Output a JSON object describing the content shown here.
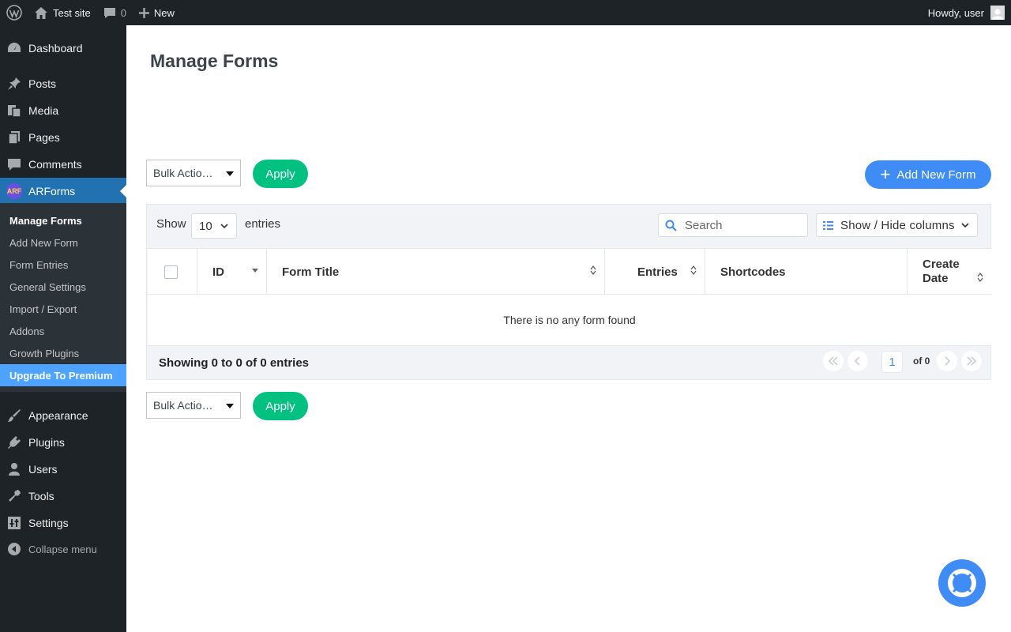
{
  "adminbar": {
    "site_name": "Test site",
    "comments_count": "0",
    "new_label": "New",
    "greeting": "Howdy, user"
  },
  "sidebar": {
    "items": [
      {
        "label": "Dashboard",
        "icon": "dashboard-icon"
      },
      {
        "label": "Posts",
        "icon": "pin-icon"
      },
      {
        "label": "Media",
        "icon": "media-icon"
      },
      {
        "label": "Pages",
        "icon": "pages-icon"
      },
      {
        "label": "Comments",
        "icon": "comment-icon"
      },
      {
        "label": "ARForms",
        "icon": "arforms-logo-icon"
      },
      {
        "label": "Appearance",
        "icon": "brush-icon"
      },
      {
        "label": "Plugins",
        "icon": "plugin-icon"
      },
      {
        "label": "Users",
        "icon": "user-icon"
      },
      {
        "label": "Tools",
        "icon": "wrench-icon"
      },
      {
        "label": "Settings",
        "icon": "settings-icon"
      }
    ],
    "arforms_logo_text": "ARF",
    "submenu": [
      "Manage Forms",
      "Add New Form",
      "Form Entries",
      "General Settings",
      "Import / Export",
      "Addons",
      "Growth Plugins",
      "Upgrade To Premium"
    ],
    "collapse_label": "Collapse menu"
  },
  "main": {
    "title": "Manage Forms",
    "bulk_actions": "Bulk Actio…",
    "apply_label": "Apply",
    "add_new_label": "Add New Form",
    "show_label": "Show",
    "entries_value": "10",
    "entries_label": "entries",
    "search_placeholder": "Search",
    "columns_label": "Show / Hide columns",
    "columns": {
      "id": "ID",
      "form_title": "Form Title",
      "entries": "Entries",
      "shortcodes": "Shortcodes",
      "create_date_1": "Create",
      "create_date_2": "Date"
    },
    "empty_message": "There is no any form found",
    "showing": "Showing 0 to 0 of 0 entries",
    "current_page": "1",
    "of_total": "of 0"
  },
  "colors": {
    "accent": "#2271b1",
    "apply": "#00c180",
    "primary_button": "#3f8cf6",
    "premium": "#4da3ff"
  }
}
